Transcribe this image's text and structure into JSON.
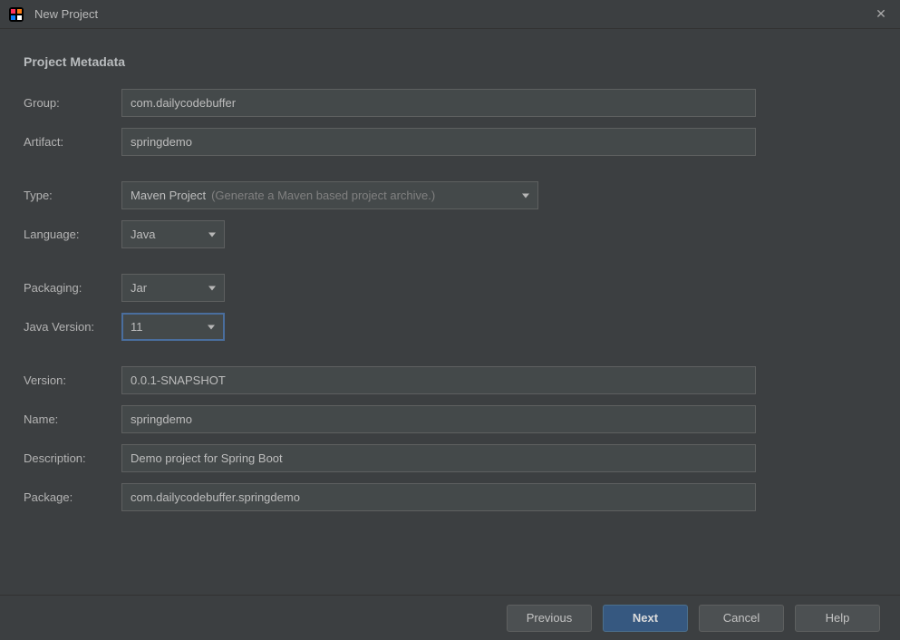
{
  "window": {
    "title": "New Project"
  },
  "section": {
    "title": "Project Metadata"
  },
  "labels": {
    "group": "Group:",
    "artifact": "Artifact:",
    "type": "Type:",
    "language": "Language:",
    "packaging": "Packaging:",
    "javaVersion": "Java Version:",
    "version": "Version:",
    "name": "Name:",
    "description": "Description:",
    "package": "Package:"
  },
  "values": {
    "group": "com.dailycodebuffer",
    "artifact": "springdemo",
    "type": "Maven Project",
    "typeHint": "(Generate a Maven based project archive.)",
    "language": "Java",
    "packaging": "Jar",
    "javaVersion": "11",
    "version": "0.0.1-SNAPSHOT",
    "name": "springdemo",
    "description": "Demo project for Spring Boot",
    "package": "com.dailycodebuffer.springdemo"
  },
  "buttons": {
    "previous": "Previous",
    "next": "Next",
    "cancel": "Cancel",
    "help": "Help"
  }
}
